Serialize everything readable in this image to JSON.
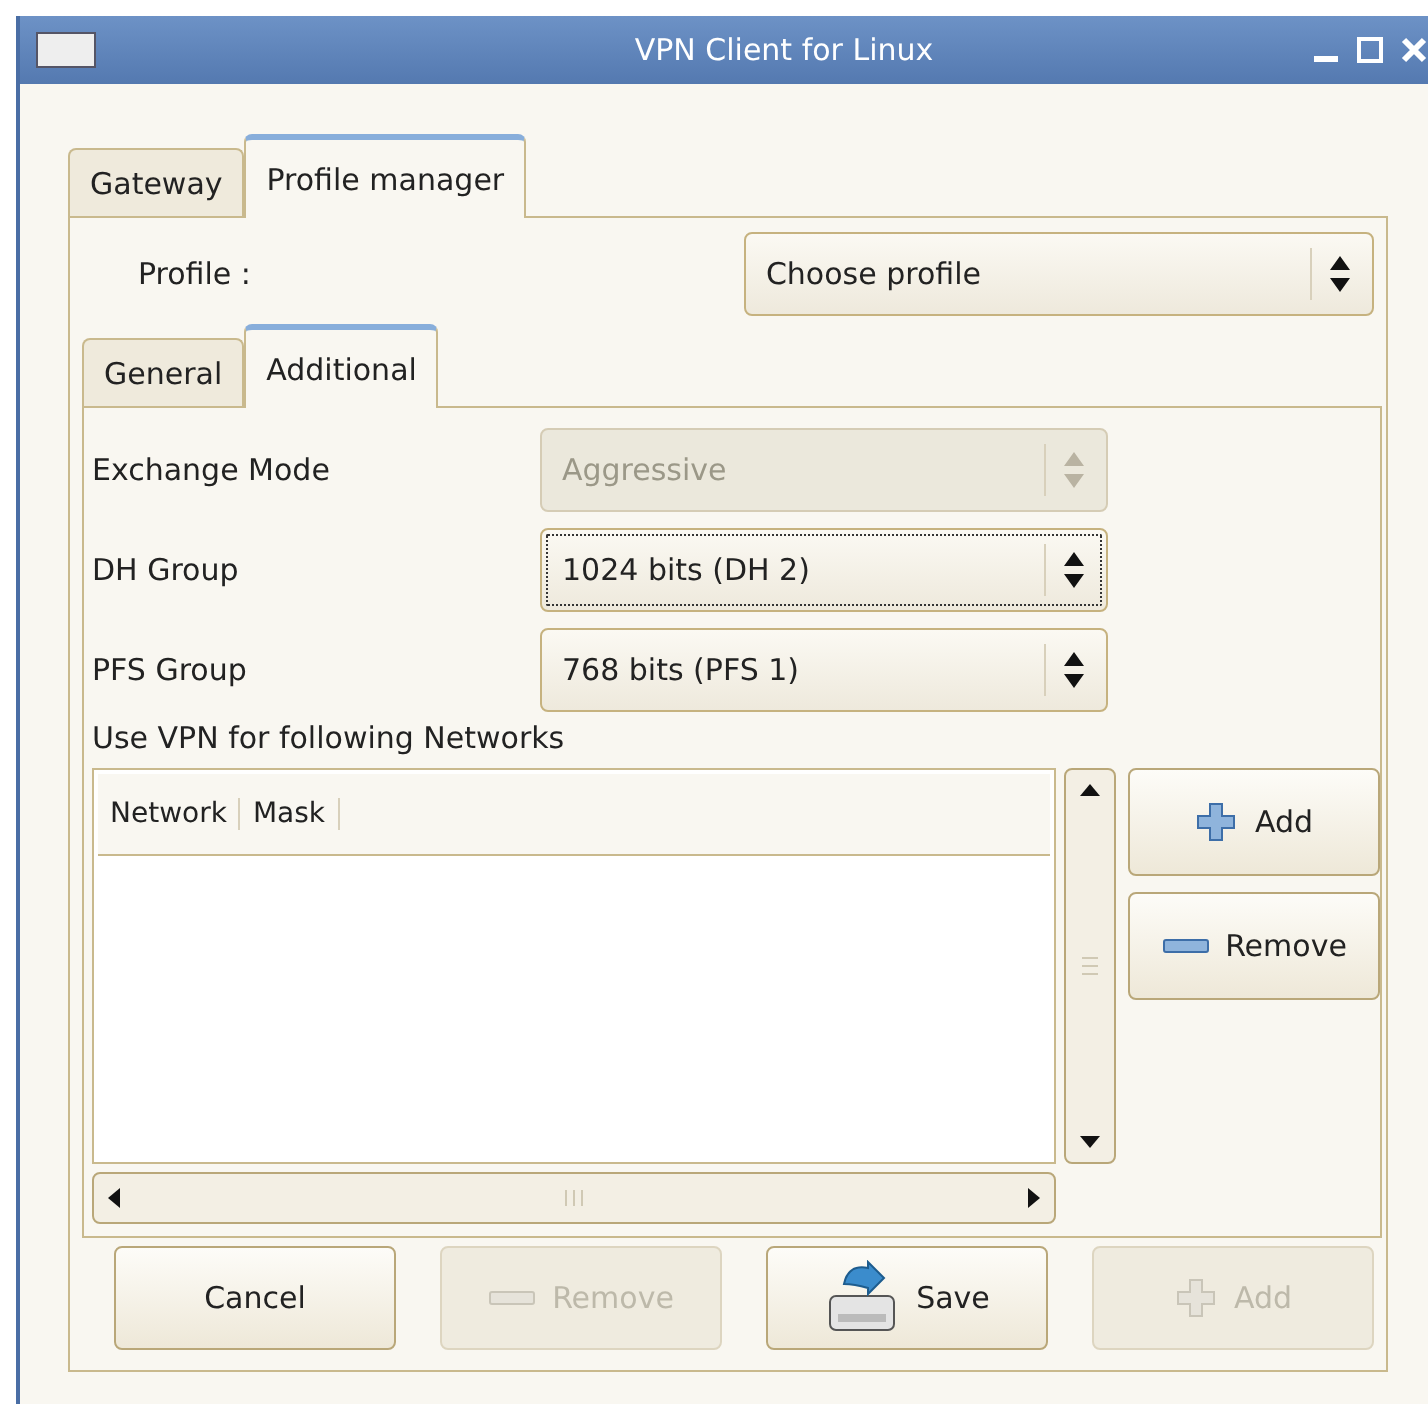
{
  "window": {
    "title": "VPN Client for Linux"
  },
  "tabs": [
    {
      "label": "Gateway",
      "selected": false
    },
    {
      "label": "Profile manager",
      "selected": true
    }
  ],
  "profile": {
    "label": "Profile :",
    "value": "Choose profile"
  },
  "subtabs": [
    {
      "label": "General",
      "selected": false
    },
    {
      "label": "Additional",
      "selected": true
    }
  ],
  "settings": [
    {
      "label": "Exchange Mode",
      "value": "Aggressive",
      "disabled": true,
      "focused": false
    },
    {
      "label": "DH Group",
      "value": "1024 bits (DH 2)",
      "disabled": false,
      "focused": true
    },
    {
      "label": "PFS Group",
      "value": "768 bits (PFS 1)",
      "disabled": false,
      "focused": false
    }
  ],
  "networks": {
    "label": "Use VPN for following Networks",
    "columns": [
      "Network",
      "Mask"
    ]
  },
  "side_buttons": [
    {
      "label": "Add",
      "kind": "plus",
      "disabled": false
    },
    {
      "label": "Remove",
      "kind": "minus",
      "disabled": false
    }
  ],
  "buttons": [
    {
      "label": "Cancel",
      "kind": "plain",
      "disabled": false
    },
    {
      "label": "Remove",
      "kind": "minus",
      "disabled": true
    },
    {
      "label": "Save",
      "kind": "save",
      "disabled": false
    },
    {
      "label": "Add",
      "kind": "plus",
      "disabled": true
    }
  ]
}
